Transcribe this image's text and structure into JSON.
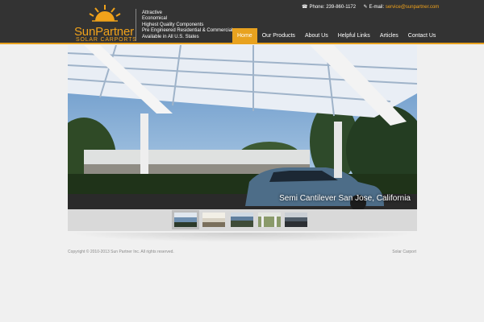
{
  "header": {
    "brand": "SunPartner",
    "brand_sub": "SOLAR CARPORTS",
    "tagline": [
      "Attractive",
      "Economical",
      "Highest Quality Components",
      "Pre Engineered Residential & Commercial",
      "Available in All U.S. States"
    ],
    "contact": {
      "phone_label": "Phone:",
      "phone": "239-860-1172",
      "email_label": "E-mail:",
      "email": "service@sunpartner.com",
      "phone_icon": "phone-icon",
      "email_icon": "pen-icon"
    },
    "nav": [
      {
        "label": "Home",
        "active": true
      },
      {
        "label": "Our Products",
        "active": false
      },
      {
        "label": "About Us",
        "active": false
      },
      {
        "label": "Helpful Links",
        "active": false
      },
      {
        "label": "Articles",
        "active": false
      },
      {
        "label": "Contact Us",
        "active": false
      }
    ]
  },
  "slider": {
    "caption": "Semi Cantilever San Jose, California",
    "thumbnails": [
      {
        "active": true
      },
      {
        "active": false
      },
      {
        "active": false
      },
      {
        "active": false
      },
      {
        "active": false
      }
    ]
  },
  "footer": {
    "copyright": "Copyright © 2010-2013 Sun Partner Inc. All rights reserved.",
    "right_link": "Solar Carport"
  },
  "colors": {
    "accent": "#e8a21f",
    "header_bg": "#333333",
    "page_bg": "#f0f0f0"
  }
}
